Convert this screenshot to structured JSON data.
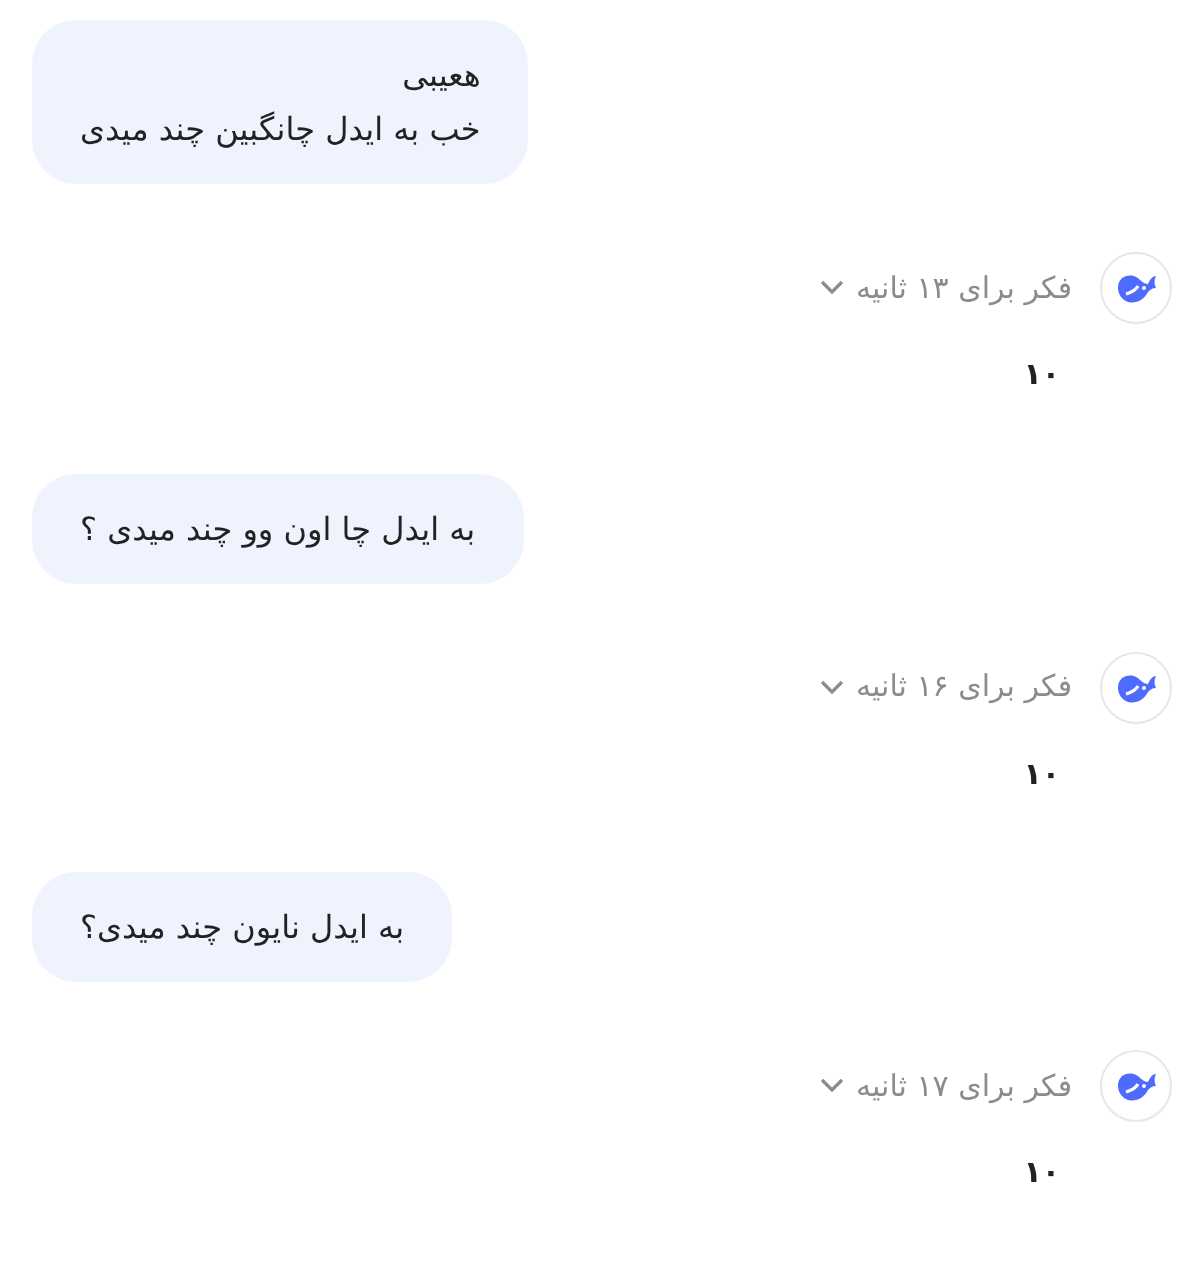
{
  "messages": [
    {
      "kind": "user",
      "lines": [
        "هعیبی",
        "خب به ایدل چانگبین چند میدی"
      ]
    },
    {
      "kind": "assistant",
      "thinking": "فکر برای ۱۳ ثانیه",
      "expanded": false,
      "answer": "۱۰"
    },
    {
      "kind": "user",
      "lines": [
        "به ایدل چا اون وو چند میدی ؟"
      ]
    },
    {
      "kind": "assistant",
      "thinking": "فکر برای ۱۶ ثانیه",
      "expanded": false,
      "answer": "۱۰"
    },
    {
      "kind": "user",
      "lines": [
        "به ایدل نایون چند میدی؟"
      ]
    },
    {
      "kind": "assistant",
      "thinking": "فکر برای ۱۷ ثانیه",
      "expanded": false,
      "answer": "۱۰"
    }
  ]
}
